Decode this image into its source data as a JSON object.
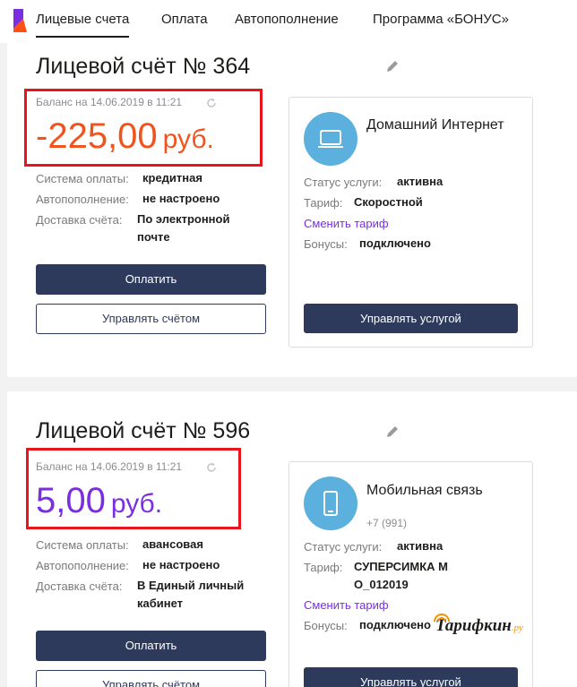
{
  "nav": {
    "items": [
      {
        "label": "Лицевые счета",
        "active": true
      },
      {
        "label": "Оплата",
        "active": false
      },
      {
        "label": "Автопополнение",
        "active": false
      },
      {
        "label": "Программа «БОНУС»",
        "active": false
      }
    ]
  },
  "accounts": [
    {
      "title": "Лицевой счёт № 364",
      "balance_label": "Баланс на 14.06.2019 в 11:21",
      "amount": "-225,00",
      "currency": "руб.",
      "amount_color": "#f0541e",
      "payment_system_label": "Система оплаты:",
      "payment_system_value": "кредитная",
      "autopay_label": "Автопополнение:",
      "autopay_value": "не настроено",
      "delivery_label": "Доставка счёта:",
      "delivery_value": "По электронной почте",
      "pay_button": "Оплатить",
      "manage_button": "Управлять счётом",
      "service": {
        "icon": "laptop-icon",
        "name": "Домашний Интернет",
        "status_label": "Статус услуги:",
        "status_value": "активна",
        "tariff_label": "Тариф:",
        "tariff_value": "Скоростной",
        "change_tariff": "Сменить тариф",
        "bonus_label": "Бонусы:",
        "bonus_value": "подключено",
        "manage_button": "Управлять услугой"
      }
    },
    {
      "title": "Лицевой счёт № 596",
      "balance_label": "Баланс на 14.06.2019 в 11:21",
      "amount": "5,00",
      "currency": "руб.",
      "amount_color": "#7b2ee0",
      "payment_system_label": "Система оплаты:",
      "payment_system_value": "авансовая",
      "autopay_label": "Автопополнение:",
      "autopay_value": "не настроено",
      "delivery_label": "Доставка счёта:",
      "delivery_value": "В Единый личный кабинет",
      "pay_button": "Оплатить",
      "manage_button": "Управлять счётом",
      "service": {
        "icon": "mobile-phone-icon",
        "name": "Мобильная связь",
        "phone": "+7 (991)",
        "status_label": "Статус услуги:",
        "status_value": "активна",
        "tariff_label": "Тариф:",
        "tariff_value": "СУПЕРСИМКА М О_012019",
        "change_tariff": "Сменить тариф",
        "bonus_label": "Бонусы:",
        "bonus_value": "подключено",
        "manage_button": "Управлять услугой"
      }
    }
  ],
  "watermark": {
    "main": "Тарифкин",
    "sub": ".ру"
  },
  "colors": {
    "brand": "#7b2ee0",
    "button": "#2e3a5c",
    "highlight": "#e8151c",
    "icon_circle": "#5bb0de"
  }
}
